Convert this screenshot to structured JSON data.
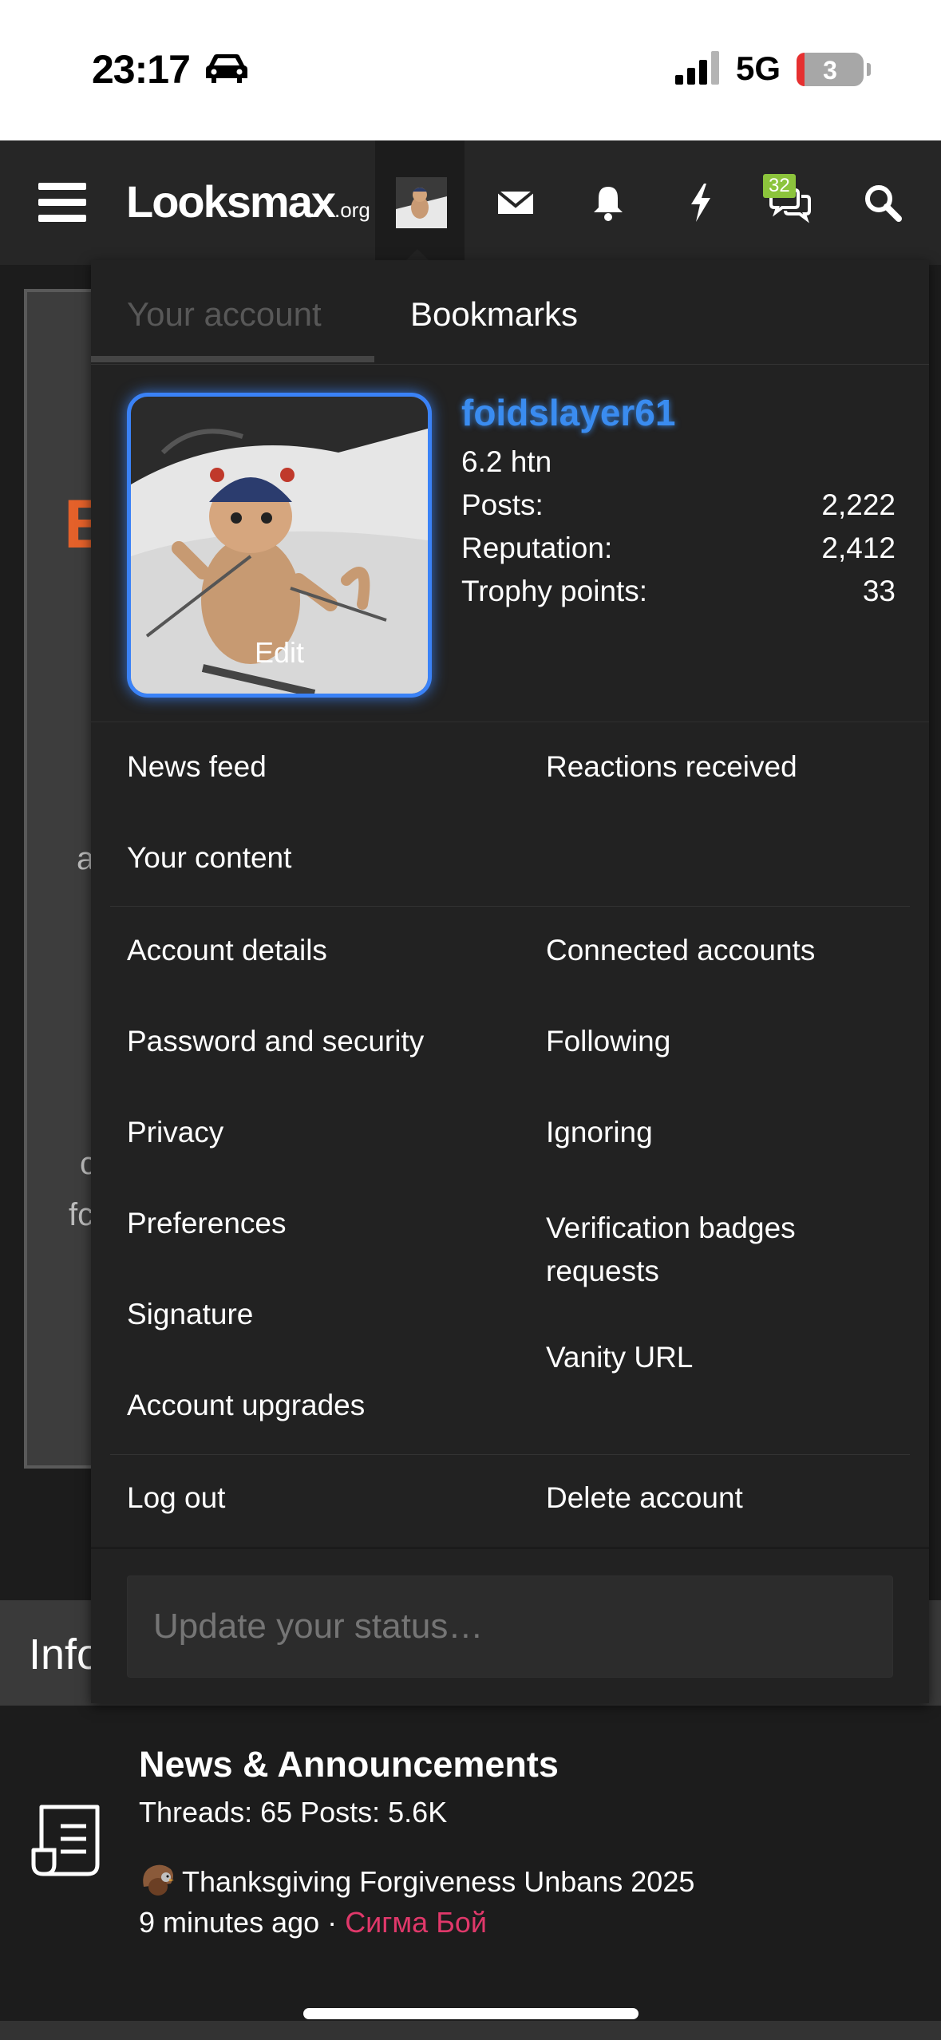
{
  "status_bar": {
    "time": "23:17",
    "network": "5G",
    "battery": "3"
  },
  "nav": {
    "logo_text": "Looksmax",
    "logo_suffix": ".org",
    "badge_count": "32"
  },
  "background_page": {
    "left_letter": "E",
    "fragments": [
      "a",
      "c",
      "fc"
    ],
    "info_label": "Info",
    "forum": {
      "title": "News & Announcements",
      "stats": "Threads: 65 Posts: 5.6K",
      "latest_thread": "Thanksgiving Forgiveness Unbans 2025",
      "latest_time": "9 minutes ago",
      "separator": "·",
      "latest_author": "Сигма Бой"
    }
  },
  "account_menu": {
    "tabs": [
      "Your account",
      "Bookmarks"
    ],
    "profile": {
      "username": "foidslayer61",
      "user_title": "6.2 htn",
      "avatar_action": "Edit",
      "stats": [
        {
          "label": "Posts:",
          "value": "2,222"
        },
        {
          "label": "Reputation:",
          "value": "2,412"
        },
        {
          "label": "Trophy points:",
          "value": "33"
        }
      ]
    },
    "section1_left": [
      "News feed",
      "Your content"
    ],
    "section1_right": [
      "Reactions received"
    ],
    "section2_left": [
      "Account details",
      "Password and security",
      "Privacy",
      "Preferences",
      "Signature",
      "Account upgrades"
    ],
    "section2_right": [
      "Connected accounts",
      "Following",
      "Ignoring",
      "Verification badges requests",
      "Vanity URL"
    ],
    "section3_left": [
      "Log out"
    ],
    "section3_right": [
      "Delete account"
    ],
    "status_placeholder": "Update your status…"
  },
  "colors": {
    "accent_username": "#3a8cf0",
    "brand_orange": "#e4612a",
    "author_pink": "#e0386a",
    "badge_green": "#8cc43c"
  }
}
